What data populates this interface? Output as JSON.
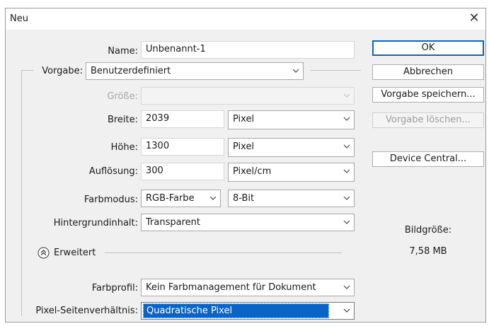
{
  "window": {
    "title": "Neu",
    "close_glyph": "✕"
  },
  "form": {
    "name": {
      "label": "Name:",
      "value": "Unbenannt-1"
    },
    "vorgabe": {
      "label": "Vorgabe:",
      "value": "Benutzerdefiniert"
    },
    "groesse": {
      "label": "Größe:",
      "value": ""
    },
    "breite": {
      "label": "Breite:",
      "value": "2039",
      "unit": "Pixel"
    },
    "hoehe": {
      "label": "Höhe:",
      "value": "1300",
      "unit": "Pixel"
    },
    "aufloesung": {
      "label": "Auflösung:",
      "value": "300",
      "unit": "Pixel/cm"
    },
    "farbmodus": {
      "label": "Farbmodus:",
      "value": "RGB-Farbe",
      "depth": "8-Bit"
    },
    "hintergrund": {
      "label": "Hintergrundinhalt:",
      "value": "Transparent"
    },
    "erweitert": {
      "label": "Erweitert"
    },
    "farbprofil": {
      "label": "Farbprofil:",
      "value": "Kein Farbmanagement für Dokument"
    },
    "pixelverhaeltnis": {
      "label": "Pixel-Seitenverhältnis:",
      "value": "Quadratische Pixel"
    }
  },
  "buttons": {
    "ok": "OK",
    "abbrechen": "Abbrechen",
    "vorgabe_speichern": "Vorgabe speichern...",
    "vorgabe_loeschen": "Vorgabe löschen...",
    "device_central": "Device Central..."
  },
  "info": {
    "bildgroesse_label": "Bildgröße:",
    "bildgroesse_value": "7,58 MB"
  },
  "icons": {
    "dropdown": "chevron-down-icon",
    "collapse": "double-chevron-up-icon"
  },
  "colors": {
    "accent": "#0a64c8",
    "background": "#f0f0f0"
  }
}
